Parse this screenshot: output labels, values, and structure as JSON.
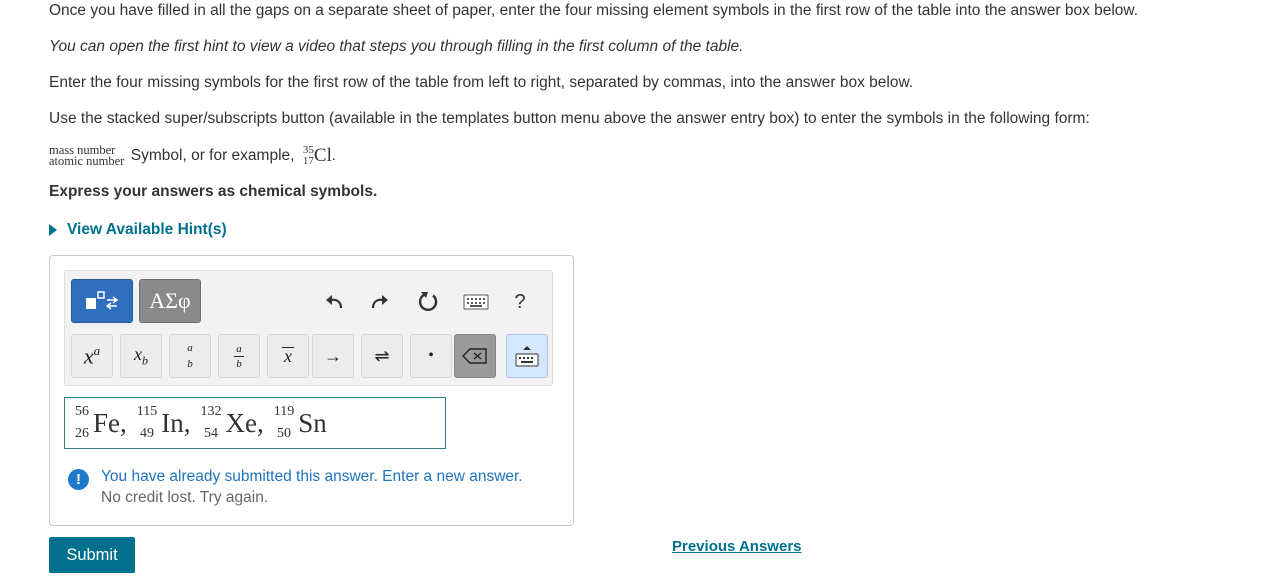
{
  "instructions": {
    "p1": "Once you have filled in all the gaps on a separate sheet of paper, enter the four missing element symbols in the first row of the table into the answer box below.",
    "p2": "You can open the first hint to view a video that steps you through filling in the first column of the table.",
    "p3": "Enter the four missing symbols for the first row of the table from left to right, separated by commas, into the answer box below.",
    "p4": "Use the stacked super/subscripts button (available in the templates button menu above the answer entry box) to enter the symbols in the following form:",
    "form_top": "mass number",
    "form_bottom": "atomic number",
    "form_text": "Symbol, or for example,",
    "example_mass": "35",
    "example_atomic": "17",
    "example_symbol": "Cl",
    "example_end": ".",
    "express": "Express your answers as chemical symbols."
  },
  "hint": {
    "label": "View Available Hint(s)"
  },
  "toolbar": {
    "greek_label": "ΑΣφ",
    "help_label": "?",
    "keys": {
      "sup_base": "x",
      "sup_exp": "a",
      "sub_base": "x",
      "sub_idx": "b",
      "stack_top": "a",
      "stack_bottom": "b",
      "frac_top": "a",
      "frac_bottom": "b",
      "vec": "x",
      "arrow": "→",
      "equilibrium": "⇌",
      "dot": "•"
    }
  },
  "answer": {
    "items": [
      {
        "mass": "56",
        "atomic": "26",
        "symbol": "Fe",
        "sep": ","
      },
      {
        "mass": "115",
        "atomic": "49",
        "symbol": "In",
        "sep": ","
      },
      {
        "mass": "132",
        "atomic": "54",
        "symbol": "Xe",
        "sep": ","
      },
      {
        "mass": "119",
        "atomic": "50",
        "symbol": "Sn",
        "sep": ""
      }
    ]
  },
  "feedback": {
    "line1": "You have already submitted this answer. Enter a new answer.",
    "line2": "No credit lost. Try again."
  },
  "actions": {
    "submit_label": "Submit",
    "previous_label": "Previous Answers"
  },
  "colors": {
    "link": "#00708f",
    "template_button": "#2f6fbd",
    "answer_border": "#2b8079",
    "info_icon": "#1e7ac9"
  }
}
